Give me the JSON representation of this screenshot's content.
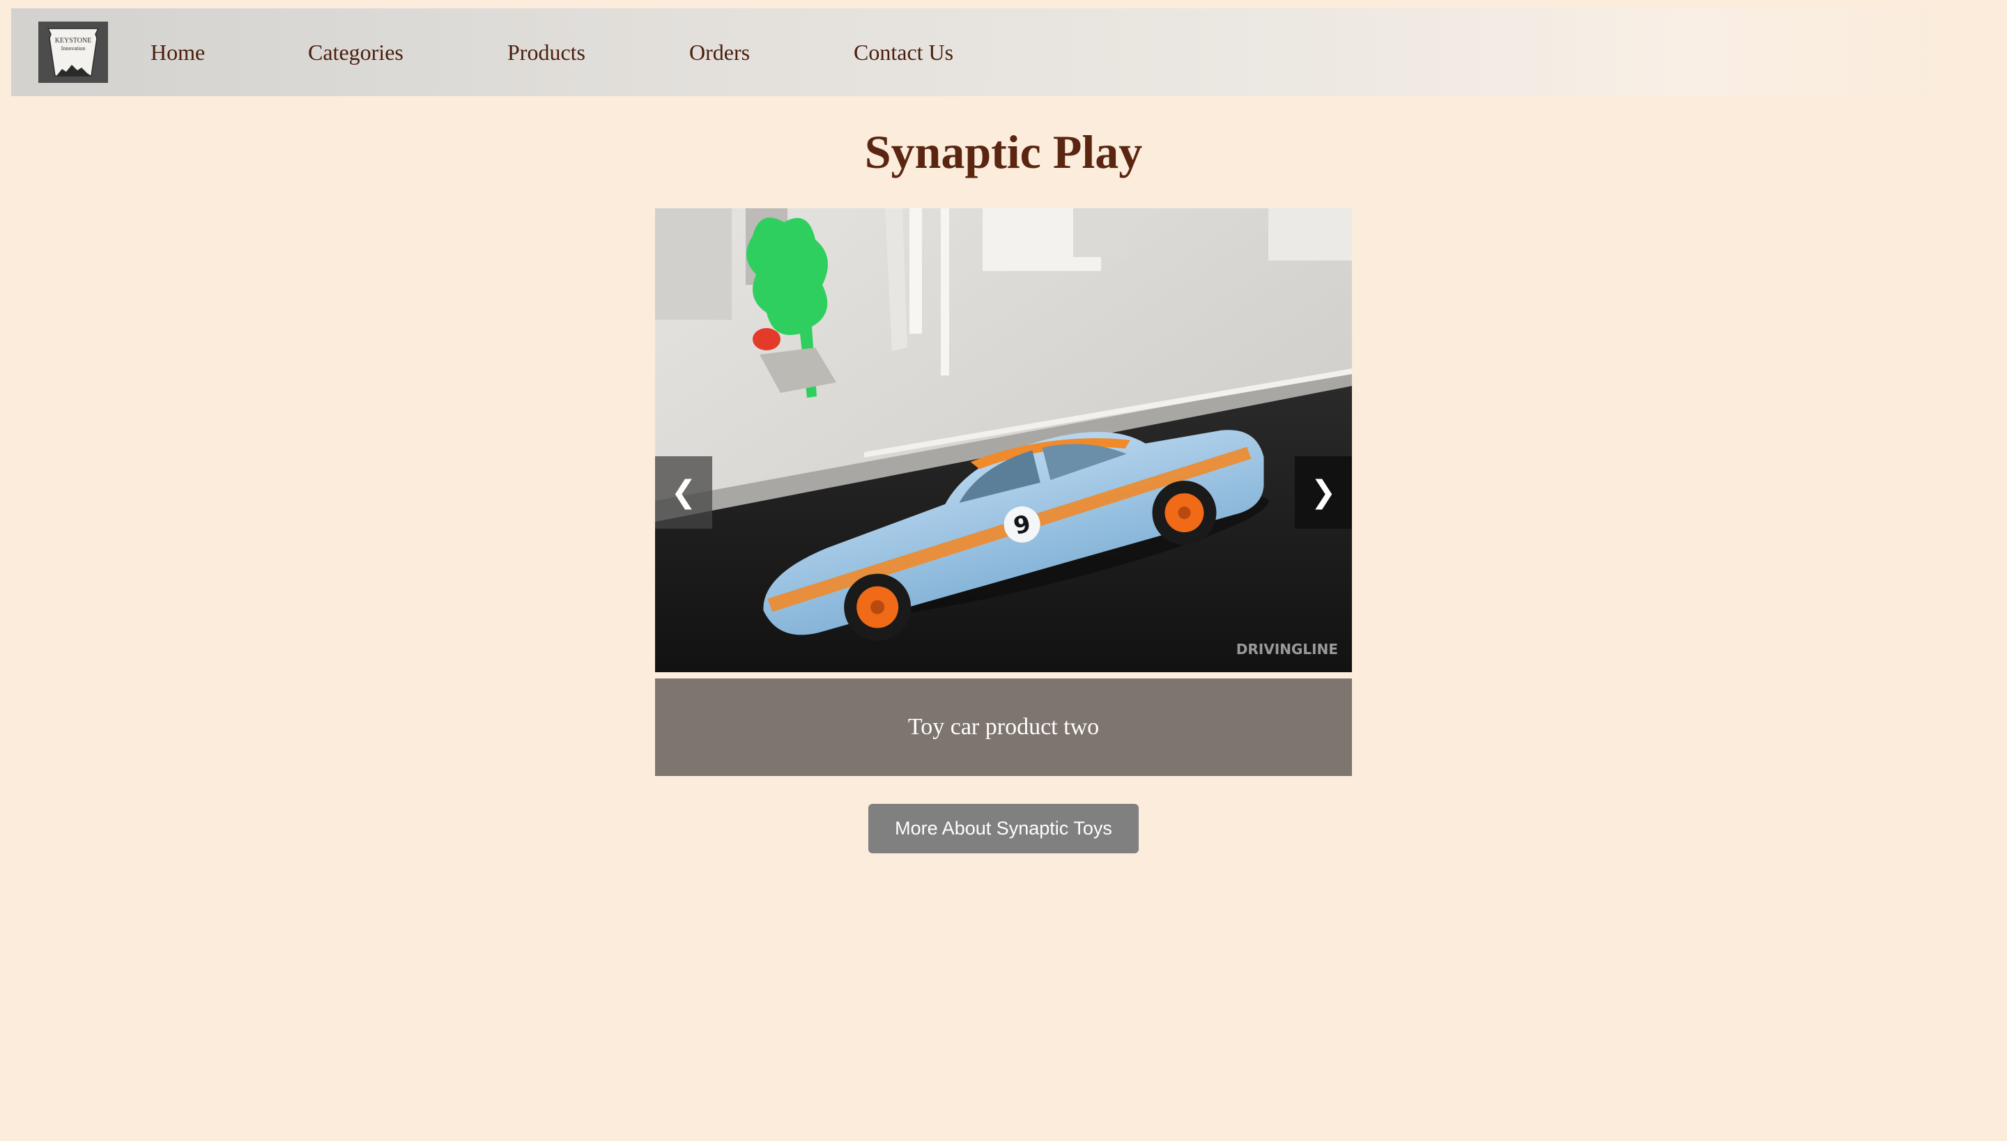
{
  "logo": {
    "line1": "KEYSTONE",
    "line2": "Innovation"
  },
  "nav": {
    "items": [
      {
        "label": "Home"
      },
      {
        "label": "Categories"
      },
      {
        "label": "Products"
      },
      {
        "label": "Orders"
      },
      {
        "label": "Contact Us"
      }
    ]
  },
  "page": {
    "title": "Synaptic Play"
  },
  "carousel": {
    "prev_glyph": "❮",
    "next_glyph": "❯",
    "caption": "Toy car product two",
    "image": {
      "car_number": "9",
      "watermark": "DRIVINGLINE"
    }
  },
  "actions": {
    "more_label": "More About Synaptic Toys"
  },
  "colors": {
    "background": "#fbecdb",
    "nav_text": "#4a1e0c",
    "title": "#5a2511",
    "caption_bg": "#7e756e",
    "button_bg": "#808080"
  },
  "icons": [
    "keystone-logo-icon",
    "chevron-left-icon",
    "chevron-right-icon"
  ]
}
